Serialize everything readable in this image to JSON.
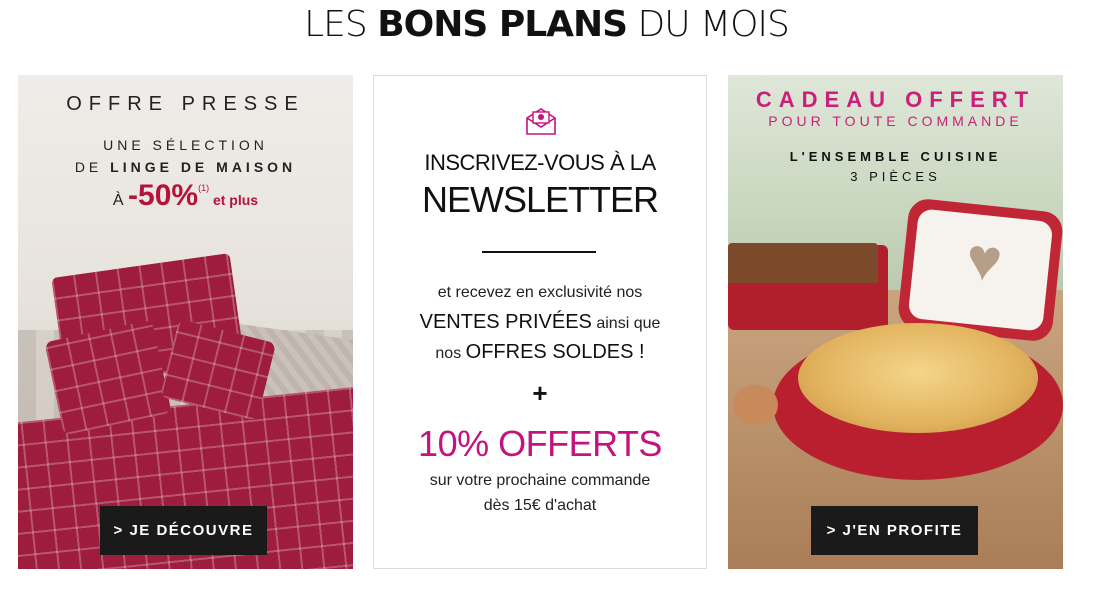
{
  "header": {
    "title_pre": "LES ",
    "title_bold": "BONS PLANS",
    "title_post": " DU MOIS"
  },
  "card_left": {
    "line1": "OFFRE PRESSE",
    "line2": "UNE SÉLECTION",
    "line3_pre": "DE ",
    "line3_bold": "LINGE DE MAISON",
    "line4_pre": "À ",
    "line4_pct": "-50%",
    "line4_sup": "(1)",
    "line4_post": " et plus",
    "button_label": "> JE DÉCOUVRE"
  },
  "card_middle": {
    "line1": "INSCRIVEZ-VOUS À LA",
    "line2": "NEWSLETTER",
    "line3": "et recevez en exclusivité nos",
    "line4_main": "VENTES PRIVÉES",
    "line4_small": " ainsi que",
    "line5_small": "nos ",
    "line5_main": "OFFRES SOLDES !",
    "plus": "+",
    "offer": "10% OFFERTS",
    "line7": "sur votre prochaine commande",
    "line8": "dès 15€ d'achat",
    "icon": "envelope-flower-icon",
    "accent_color": "#c4137d"
  },
  "card_right": {
    "line1": "CADEAU OFFERT",
    "line2": "POUR TOUTE COMMANDE",
    "line3": "L'ENSEMBLE CUISINE",
    "line4": "3 PIÈCES",
    "button_label": "> J'EN PROFITE",
    "accent_color": "#cc1f7a"
  }
}
